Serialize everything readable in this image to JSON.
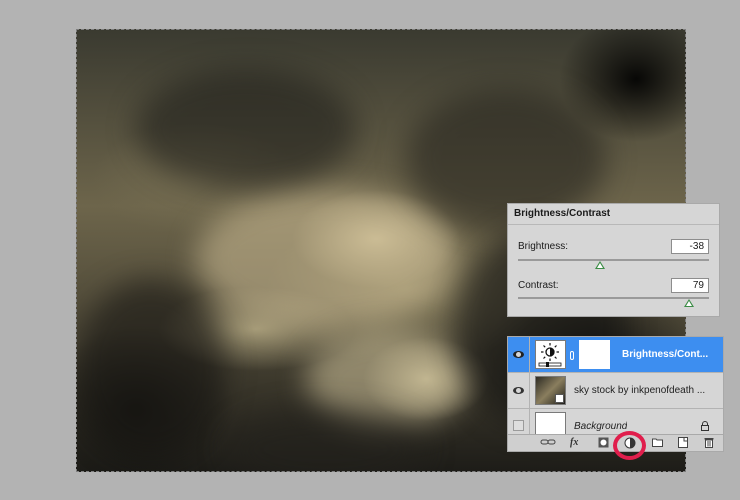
{
  "properties": {
    "title": "Brightness/Contrast",
    "brightness_label": "Brightness:",
    "brightness_value": "-38",
    "contrast_label": "Contrast:",
    "contrast_value": "79",
    "brightness_slider_fraction": 0.431,
    "contrast_slider_fraction": 0.895
  },
  "layers": [
    {
      "name": "Brightness/Cont...",
      "visible": true,
      "selected": true,
      "type": "adjustment"
    },
    {
      "name": "sky stock by inkpenofdeath ...",
      "visible": true,
      "selected": false,
      "type": "smart-object"
    },
    {
      "name": "Background",
      "visible": false,
      "selected": false,
      "locked": true,
      "type": "background"
    }
  ],
  "footer_icons": [
    "link-icon",
    "fx-icon",
    "mask-icon",
    "adjustment-layer-icon",
    "group-icon",
    "new-layer-icon",
    "trash-icon"
  ],
  "fx_label": "fx",
  "colors": {
    "highlight": "#e01e4c",
    "selection": "#3d8ef0"
  }
}
